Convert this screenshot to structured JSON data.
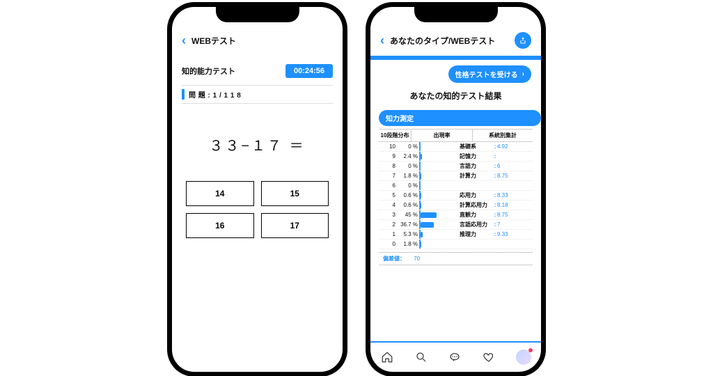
{
  "phone1": {
    "header_title": "WEBテスト",
    "subtitle": "知的能力テスト",
    "timer": "00:24:56",
    "question_counter": "問 題 : 1  /  1 1 8",
    "problem": "３３−１７ ＝",
    "answers": [
      "14",
      "15",
      "16",
      "17"
    ]
  },
  "phone2": {
    "header_title": "あなたのタイプ/WEBテスト",
    "cta": "性格テストを受ける",
    "result_title": "あなたの知的テスト結果",
    "chip": "知力測定",
    "col0": "10段階分布",
    "col1": "出現率",
    "col2": "系統別集計",
    "rows": [
      {
        "lv": "10",
        "pct": "0 %",
        "bar": 0,
        "lab": "基礎系",
        "val": "4.92"
      },
      {
        "lv": "9",
        "pct": "2.4 %",
        "bar": 3,
        "lab": "記憶力",
        "val": ""
      },
      {
        "lv": "8",
        "pct": "0 %",
        "bar": 0,
        "lab": "言語力",
        "val": "6"
      },
      {
        "lv": "7",
        "pct": "1.8 %",
        "bar": 2,
        "lab": "計算力",
        "val": "8.75"
      },
      {
        "lv": "6",
        "pct": "0 %",
        "bar": 0,
        "lab": "",
        "val": ""
      },
      {
        "lv": "5",
        "pct": "0.6 %",
        "bar": 1,
        "lab": "応用力",
        "val": "8.33"
      },
      {
        "lv": "4",
        "pct": "0.6 %",
        "bar": 1,
        "lab": "計算応用力",
        "val": "8.18"
      },
      {
        "lv": "3",
        "pct": "45 %",
        "bar": 45,
        "lab": "直観力",
        "val": "8.75"
      },
      {
        "lv": "2",
        "pct": "36.7 %",
        "bar": 37,
        "lab": "言語応用力",
        "val": "7"
      },
      {
        "lv": "1",
        "pct": "5.3 %",
        "bar": 6,
        "lab": "推理力",
        "val": "9.33"
      },
      {
        "lv": "0",
        "pct": "1.8 %",
        "bar": 2,
        "lab": "",
        "val": ""
      }
    ],
    "hensachi_label": "偏差値：",
    "hensachi_value": "70"
  },
  "chart_data": {
    "type": "bar",
    "title": "10段階分布 出現率",
    "xlabel": "10段階分布",
    "ylabel": "出現率 (%)",
    "ylim": [
      0,
      50
    ],
    "categories": [
      10,
      9,
      8,
      7,
      6,
      5,
      4,
      3,
      2,
      1,
      0
    ],
    "values": [
      0,
      2.4,
      0,
      1.8,
      0,
      0.6,
      0.6,
      45,
      36.7,
      5.3,
      1.8
    ],
    "aux_series": {
      "name": "系統別集計",
      "labels": [
        "基礎系",
        "記憶力",
        "言語力",
        "計算力",
        "応用力",
        "計算応用力",
        "直観力",
        "言語応用力",
        "推理力"
      ],
      "values": [
        4.92,
        null,
        6,
        8.75,
        8.33,
        8.18,
        8.75,
        7,
        9.33
      ]
    }
  }
}
